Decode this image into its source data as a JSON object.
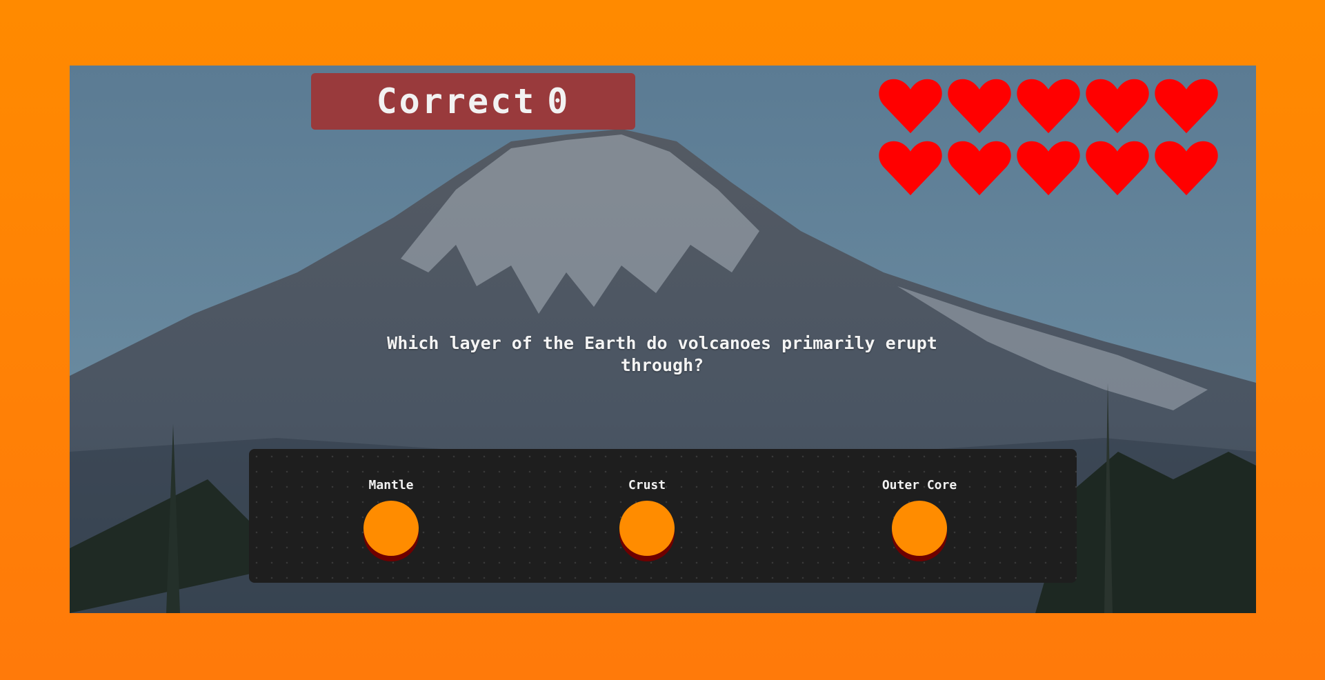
{
  "score": {
    "label": "Correct",
    "value": "0"
  },
  "lives": {
    "count": 10,
    "color": "#ff0000"
  },
  "question": "Which layer of the Earth do volcanoes primarily erupt through?",
  "options": [
    {
      "label": "Mantle"
    },
    {
      "label": "Crust"
    },
    {
      "label": "Outer Core"
    }
  ],
  "colors": {
    "frame": "#ff8a00",
    "score_bg": "#993a3c",
    "panel_bg": "#1e1e1e",
    "button": "#ff8c00",
    "button_shadow": "#6e0000"
  },
  "background": "snow-capped-volcano-photo"
}
